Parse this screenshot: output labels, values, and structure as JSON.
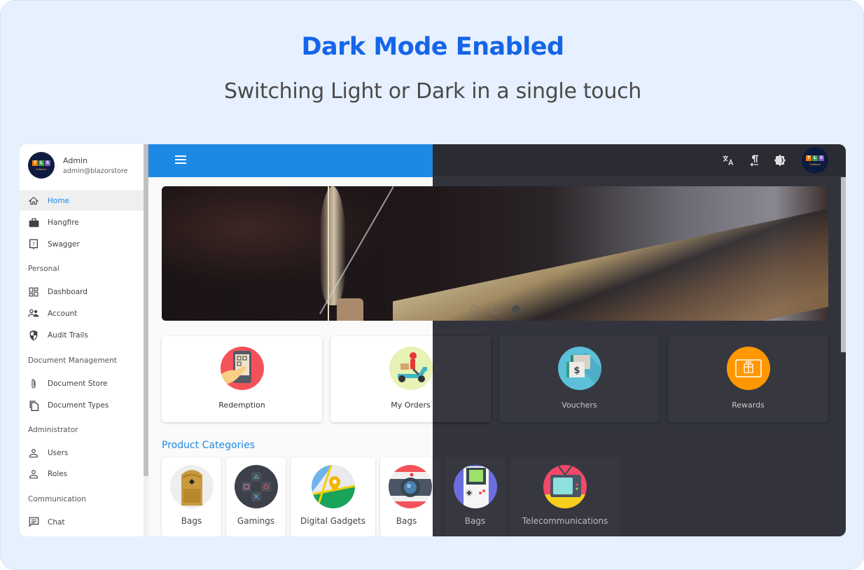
{
  "banner": {
    "title": "Dark Mode Enabled",
    "subtitle": "Switching Light or Dark in a single touch",
    "title_color": "#1565e8"
  },
  "profile": {
    "name": "Admin",
    "email": "admin@blazorstore",
    "logo_letters": [
      "T",
      "L",
      "S"
    ],
    "logo_caption": "Software"
  },
  "sidebar": {
    "items": [
      {
        "label": "Home",
        "icon": "home-icon",
        "active": true
      },
      {
        "label": "Hangfire",
        "icon": "briefcase-icon"
      },
      {
        "label": "Swagger",
        "icon": "help-box-icon"
      }
    ],
    "groups": [
      {
        "title": "Personal",
        "items": [
          {
            "label": "Dashboard",
            "icon": "dashboard-icon"
          },
          {
            "label": "Account",
            "icon": "people-icon"
          },
          {
            "label": "Audit Trails",
            "icon": "shield-icon"
          }
        ]
      },
      {
        "title": "Document Management",
        "items": [
          {
            "label": "Document Store",
            "icon": "paperclip-icon"
          },
          {
            "label": "Document Types",
            "icon": "copy-icon"
          }
        ]
      },
      {
        "title": "Administrator",
        "items": [
          {
            "label": "Users",
            "icon": "person-icon"
          },
          {
            "label": "Roles",
            "icon": "person-icon"
          }
        ]
      },
      {
        "title": "Communication",
        "items": [
          {
            "label": "Chat",
            "icon": "chat-icon"
          }
        ]
      }
    ]
  },
  "topbar": {
    "menu_icon": "menu-icon",
    "actions": [
      "translate-icon",
      "text-direction-icon",
      "brightness-icon",
      "avatar"
    ],
    "light_color": "#1e88e5",
    "dark_color": "#2b2b33"
  },
  "carousel": {
    "slides": 3,
    "active_index": 2
  },
  "features": [
    {
      "label": "Redemption",
      "icon": "qr-phone-icon"
    },
    {
      "label": "My Orders",
      "icon": "scooter-delivery-icon"
    },
    {
      "label": "Vouchers",
      "icon": "voucher-icon"
    },
    {
      "label": "Rewards",
      "icon": "gift-card-icon"
    }
  ],
  "categories_title": "Product Categories",
  "categories": [
    {
      "label": "Bags",
      "icon": "backpack-icon"
    },
    {
      "label": "Gamings",
      "icon": "gamepad-icon"
    },
    {
      "label": "Digital Gadgets",
      "icon": "map-pin-icon"
    },
    {
      "label": "Bags",
      "icon": "camera-icon"
    },
    {
      "label": "Bags",
      "icon": "gameboy-icon"
    },
    {
      "label": "Telecommunications",
      "icon": "tv-icon"
    }
  ]
}
